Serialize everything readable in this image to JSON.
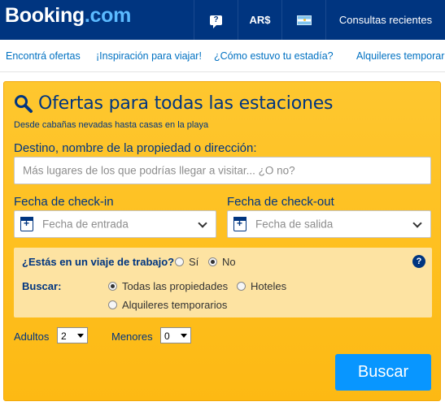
{
  "header": {
    "logo_main": "Booking",
    "logo_com": ".com",
    "help_icon": "question-bubble-icon",
    "currency": "AR$",
    "flag_icon": "argentina-flag-icon",
    "recent": "Consultas recientes"
  },
  "nav": {
    "items": [
      {
        "label": "Encontrá ofertas"
      },
      {
        "label": "¡Inspiración para viajar!"
      },
      {
        "label": "¿Cómo estuvo tu estadía?"
      },
      {
        "label": "Alquileres temporarios"
      }
    ]
  },
  "search": {
    "title": "Ofertas para todas las estaciones",
    "subtitle": "Desde cabañas nevadas hasta casas en la playa",
    "destination_label": "Destino, nombre de la propiedad o dirección:",
    "destination_placeholder": "Más lugares de los que podrías llegar a visitar... ¿O no?",
    "checkin_label": "Fecha de check-in",
    "checkin_placeholder": "Fecha de entrada",
    "checkout_label": "Fecha de check-out",
    "checkout_placeholder": "Fecha de salida",
    "work_trip_question": "¿Estás en un viaje de trabajo?",
    "work_trip_yes": "Sí",
    "work_trip_no": "No",
    "work_trip_selected": "No",
    "search_for_label": "Buscar:",
    "property_options": [
      {
        "label": "Todas las propiedades",
        "selected": true
      },
      {
        "label": "Hoteles",
        "selected": false
      },
      {
        "label": "Alquileres temporarios",
        "selected": false
      }
    ],
    "adults_label": "Adultos",
    "adults_value": "2",
    "children_label": "Menores",
    "children_value": "0",
    "submit_label": "Buscar"
  },
  "colors": {
    "brand_blue": "#003580",
    "link_blue": "#0071c2",
    "accent_yellow": "#febb02",
    "button_blue": "#0896ff"
  }
}
